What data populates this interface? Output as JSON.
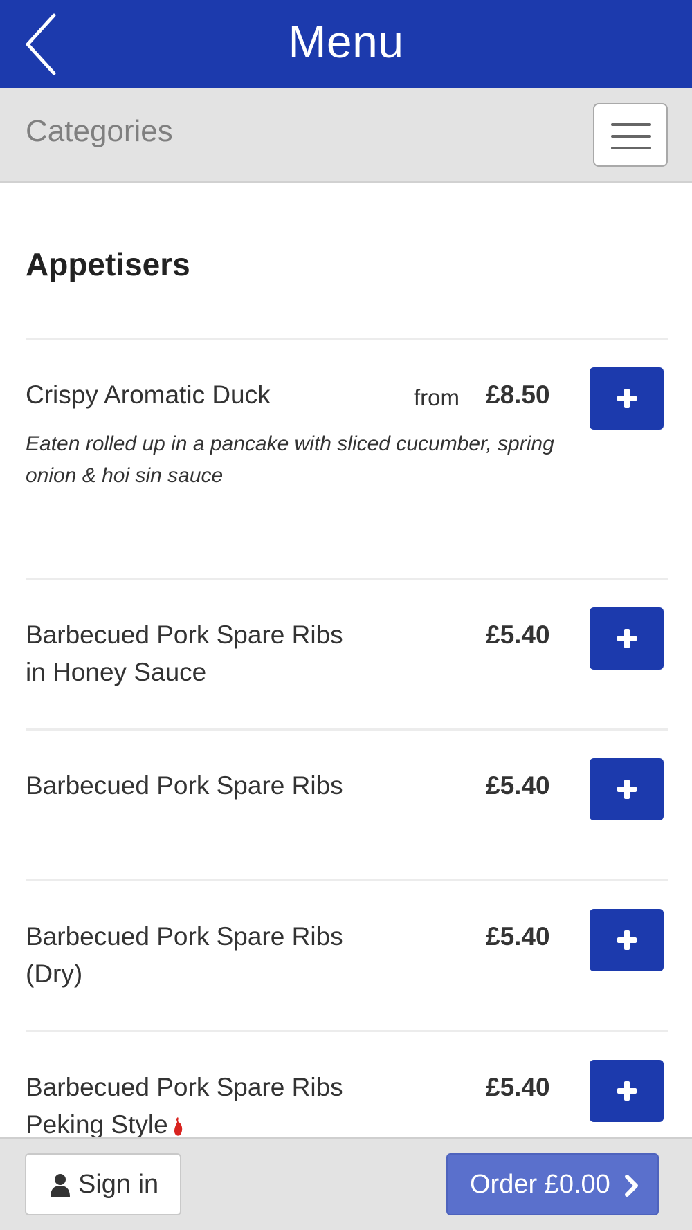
{
  "header": {
    "title": "Menu",
    "back_icon": "chevron-left-icon"
  },
  "categories_bar": {
    "label": "Categories",
    "menu_icon": "hamburger-icon"
  },
  "section": {
    "title": "Appetisers"
  },
  "items": [
    {
      "name": "Crispy Aromatic Duck",
      "from_label": "from",
      "price": "£8.50",
      "description": "Eaten rolled up in a pancake with sliced cucumber, spring onion & hoi sin sauce"
    },
    {
      "name": "Barbecued Pork Spare Ribs in Honey Sauce",
      "price": "£5.40"
    },
    {
      "name": "Barbecued Pork Spare Ribs",
      "price": "£5.40"
    },
    {
      "name": "Barbecued Pork Spare Ribs (Dry)",
      "price": "£5.40"
    },
    {
      "name": "Barbecued Pork Spare Ribs Peking Style",
      "price": "£5.40",
      "spicy_icon": "chili-icon"
    }
  ],
  "footer": {
    "signin_label": "Sign in",
    "signin_icon": "user-icon",
    "order_label": "Order £0.00",
    "order_icon": "chevron-right-icon"
  },
  "colors": {
    "brand_blue": "#1c3aad",
    "order_button": "#5a70cc",
    "bar_gray": "#e3e3e3",
    "chili_red": "#d8231f"
  }
}
